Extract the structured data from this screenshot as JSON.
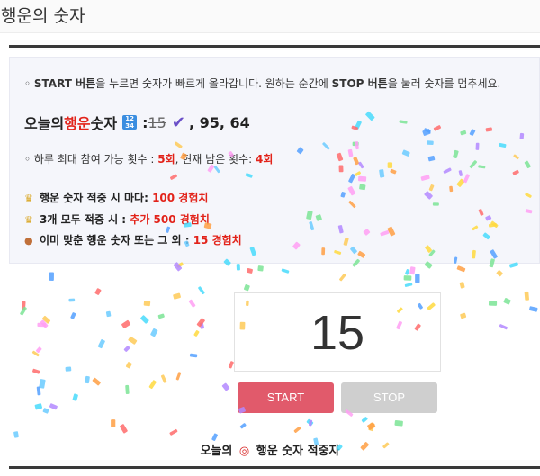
{
  "page": {
    "title": "행운의 숫자"
  },
  "info": {
    "intro": {
      "p1": "◦ ",
      "start": "START 버튼",
      "p2": "을 누르면 숫자가 빠르게 올라갑니다. 원하는 순간에 ",
      "stop": "STOP 버튼",
      "p3": "을 눌러 숫자를 멈추세요."
    },
    "today": {
      "prefix": "오늘의 ",
      "highlight": "행운",
      "suffix": " 숫자",
      "colon": " : ",
      "struck_number": "15",
      "rest_numbers": ", 95, 64",
      "numbers_icon": "numbers-icon",
      "check_icon": "check-icon"
    },
    "limit": {
      "p1": "◦ 하루 최대 참여 가능 횟수 : ",
      "max": "5회",
      "p2": ", 현재 남은 횟수: ",
      "remaining": "4회"
    },
    "rewards": [
      {
        "icon": "crown-icon",
        "text": "행운 숫자 적중 시 마다: ",
        "value": "100 경험치"
      },
      {
        "icon": "crown-icon",
        "text": "3개 모두 적중 시 : ",
        "value": "추가 500 경험치"
      },
      {
        "icon": "medal-icon",
        "text": "이미 맞춘 행운 숫자 또는 그 외 : ",
        "value": "15 경험치"
      }
    ]
  },
  "game": {
    "current_number": "15",
    "start_label": "START",
    "stop_label": "STOP"
  },
  "winners": {
    "prefix": "오늘의",
    "icon": "target-icon",
    "suffix": "행운 숫자 적중자"
  },
  "colors": {
    "accent_red": "#e2231a",
    "start_button": "#e15a6b",
    "stop_button": "#cfcfcf",
    "info_background": "#f5f6fb"
  }
}
